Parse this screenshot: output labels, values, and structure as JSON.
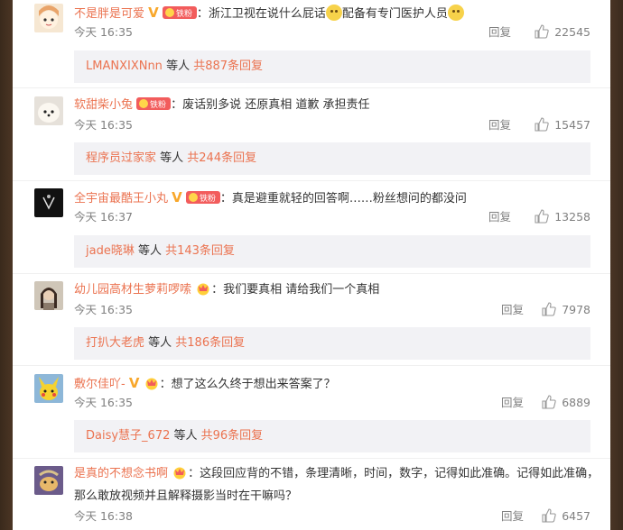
{
  "comments": [
    {
      "user": "不是胖是可爱",
      "badges": [
        "v",
        "fan"
      ],
      "text_before": "：浙江卫视在说什么屁话",
      "text_after": "配备有专门医护人员",
      "time": "今天 16:35",
      "reply_label": "回复",
      "likes": "22545",
      "sub_user": "LMANXIXNnn",
      "sub_mid": " 等人 ",
      "sub_count": "共887条回复"
    },
    {
      "user": "软甜柴小兔",
      "badges": [
        "fan"
      ],
      "text_before": "：废话别多说 还原真相 道歉 承担责任",
      "time": "今天 16:35",
      "reply_label": "回复",
      "likes": "15457",
      "sub_user": "程序员过家家",
      "sub_mid": " 等人 ",
      "sub_count": "共244条回复"
    },
    {
      "user": "全宇宙最酷王小丸",
      "badges": [
        "v",
        "fan"
      ],
      "text_before": "：真是避重就轻的回答啊……粉丝想问的都没问",
      "time": "今天 16:37",
      "reply_label": "回复",
      "likes": "13258",
      "sub_user": "jade晓琳",
      "sub_mid": " 等人 ",
      "sub_count": "共143条回复"
    },
    {
      "user": "幼儿园高材生萝莉啰嗦",
      "badges": [
        "crown"
      ],
      "text_before": "：我们要真相 请给我们一个真相",
      "time": "今天 16:35",
      "reply_label": "回复",
      "likes": "7978",
      "sub_user": "打扒大老虎",
      "sub_mid": " 等人 ",
      "sub_count": "共186条回复"
    },
    {
      "user": "敷尔佳吖-",
      "badges": [
        "v",
        "crown"
      ],
      "text_before": "：想了这么久终于想出来答案了？",
      "time": "今天 16:35",
      "reply_label": "回复",
      "likes": "6889",
      "sub_user": "Daisy慧子_672",
      "sub_mid": " 等人 ",
      "sub_count": "共96条回复"
    },
    {
      "user": "是真的不想念书啊",
      "badges": [
        "crown"
      ],
      "text_before": "：这段回应背的不错，条理清晰，时间，数字，记得如此准确。记得如此准确，那么敢放视频并且解释摄影当时在干嘛吗？",
      "time": "今天 16:38",
      "reply_label": "回复",
      "likes": "6457"
    }
  ],
  "badge_text": {
    "fan": "铁粉"
  },
  "colors": {
    "username": "#eb7350",
    "meta": "#808080",
    "subbar_bg": "#f2f2f5"
  }
}
